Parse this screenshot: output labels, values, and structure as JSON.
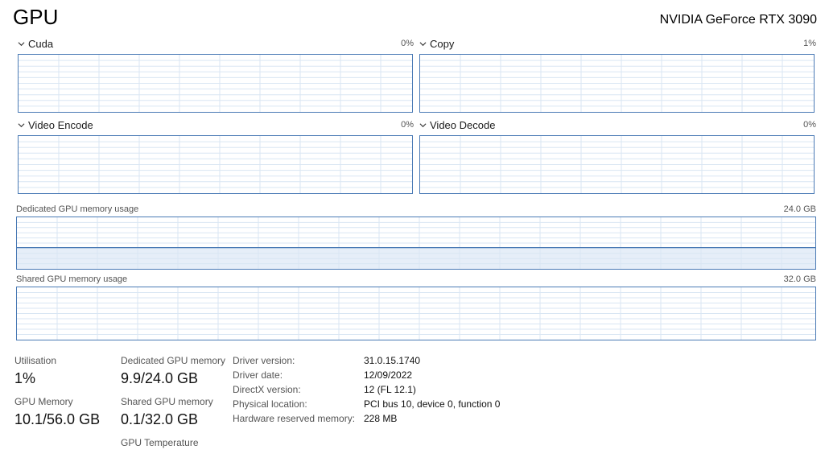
{
  "header": {
    "title": "GPU",
    "model": "NVIDIA GeForce RTX 3090"
  },
  "engines": [
    {
      "name": "Cuda",
      "value": "0%"
    },
    {
      "name": "Copy",
      "value": "1%"
    },
    {
      "name": "Video Encode",
      "value": "0%"
    },
    {
      "name": "Video Decode",
      "value": "0%"
    }
  ],
  "dedicated_memory": {
    "label": "Dedicated GPU memory usage",
    "max": "24.0 GB",
    "used_fraction": 0.4125
  },
  "shared_memory": {
    "label": "Shared GPU memory usage",
    "max": "32.0 GB"
  },
  "stats": {
    "utilisation": {
      "label": "Utilisation",
      "value": "1%"
    },
    "dedicated": {
      "label": "Dedicated GPU memory",
      "value": "9.9/24.0 GB"
    },
    "gpu_memory": {
      "label": "GPU Memory",
      "value": "10.1/56.0 GB"
    },
    "shared": {
      "label": "Shared GPU memory",
      "value": "0.1/32.0 GB"
    },
    "temperature": {
      "label": "GPU Temperature"
    }
  },
  "info": [
    {
      "label": "Driver version:",
      "value": "31.0.15.1740"
    },
    {
      "label": "Driver date:",
      "value": "12/09/2022"
    },
    {
      "label": "DirectX version:",
      "value": "12 (FL 12.1)"
    },
    {
      "label": "Physical location:",
      "value": "PCI bus 10, device 0, function 0"
    },
    {
      "label": "Hardware reserved memory:",
      "value": "228 MB"
    }
  ],
  "colors": {
    "graph_border": "#4a7ab5",
    "grid": "#d9e6f3",
    "fill": "#e6eef8"
  }
}
